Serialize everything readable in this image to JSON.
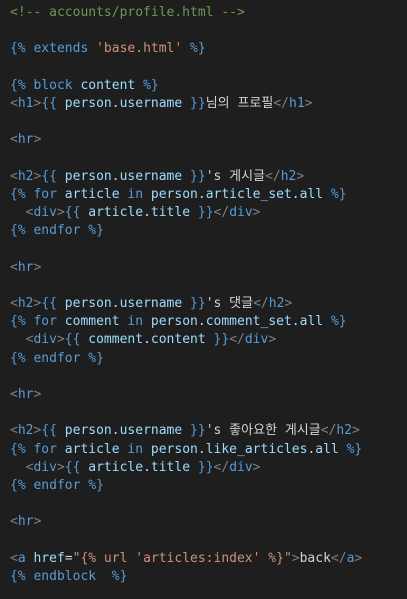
{
  "colors": {
    "background": "#1e1e1e",
    "comment": "#6a9955",
    "delimiter": "#569cd6",
    "keyword": "#569cd6",
    "identifier": "#9cdcfe",
    "string": "#ce9178",
    "punctuation": "#808080",
    "tag": "#569cd6",
    "text": "#d4d4d4",
    "attribute": "#9cdcfe"
  },
  "code_lines": [
    [
      [
        "comment",
        "<!-- accounts/profile.html -->"
      ]
    ],
    [],
    [
      [
        "delim",
        "{%"
      ],
      [
        "text",
        " "
      ],
      [
        "keyword",
        "extends"
      ],
      [
        "text",
        " "
      ],
      [
        "string",
        "'base.html'"
      ],
      [
        "text",
        " "
      ],
      [
        "delim",
        "%}"
      ]
    ],
    [],
    [
      [
        "delim",
        "{%"
      ],
      [
        "text",
        " "
      ],
      [
        "keyword",
        "block"
      ],
      [
        "text",
        " "
      ],
      [
        "ident",
        "content"
      ],
      [
        "text",
        " "
      ],
      [
        "delim",
        "%}"
      ]
    ],
    [
      [
        "punct",
        "<"
      ],
      [
        "tag",
        "h1"
      ],
      [
        "punct",
        ">"
      ],
      [
        "delim",
        "{{"
      ],
      [
        "text",
        " "
      ],
      [
        "ident",
        "person"
      ],
      [
        "text",
        "."
      ],
      [
        "ident",
        "username"
      ],
      [
        "text",
        " "
      ],
      [
        "delim",
        "}}"
      ],
      [
        "text",
        "님의 프로필"
      ],
      [
        "punct",
        "</"
      ],
      [
        "tag",
        "h1"
      ],
      [
        "punct",
        ">"
      ]
    ],
    [],
    [
      [
        "punct",
        "<"
      ],
      [
        "tag",
        "hr"
      ],
      [
        "punct",
        ">"
      ]
    ],
    [],
    [
      [
        "punct",
        "<"
      ],
      [
        "tag",
        "h2"
      ],
      [
        "punct",
        ">"
      ],
      [
        "delim",
        "{{"
      ],
      [
        "text",
        " "
      ],
      [
        "ident",
        "person"
      ],
      [
        "text",
        "."
      ],
      [
        "ident",
        "username"
      ],
      [
        "text",
        " "
      ],
      [
        "delim",
        "}}"
      ],
      [
        "text",
        "'s 게시글"
      ],
      [
        "punct",
        "</"
      ],
      [
        "tag",
        "h2"
      ],
      [
        "punct",
        ">"
      ]
    ],
    [
      [
        "delim",
        "{%"
      ],
      [
        "text",
        " "
      ],
      [
        "keyword",
        "for"
      ],
      [
        "text",
        " "
      ],
      [
        "ident",
        "article"
      ],
      [
        "text",
        " "
      ],
      [
        "keyword",
        "in"
      ],
      [
        "text",
        " "
      ],
      [
        "ident",
        "person"
      ],
      [
        "text",
        "."
      ],
      [
        "ident",
        "article_set"
      ],
      [
        "text",
        "."
      ],
      [
        "ident",
        "all"
      ],
      [
        "text",
        " "
      ],
      [
        "delim",
        "%}"
      ]
    ],
    [
      [
        "text",
        "  "
      ],
      [
        "punct",
        "<"
      ],
      [
        "tag",
        "div"
      ],
      [
        "punct",
        ">"
      ],
      [
        "delim",
        "{{"
      ],
      [
        "text",
        " "
      ],
      [
        "ident",
        "article"
      ],
      [
        "text",
        "."
      ],
      [
        "ident",
        "title"
      ],
      [
        "text",
        " "
      ],
      [
        "delim",
        "}}"
      ],
      [
        "punct",
        "</"
      ],
      [
        "tag",
        "div"
      ],
      [
        "punct",
        ">"
      ]
    ],
    [
      [
        "delim",
        "{%"
      ],
      [
        "text",
        " "
      ],
      [
        "keyword",
        "endfor"
      ],
      [
        "text",
        " "
      ],
      [
        "delim",
        "%}"
      ]
    ],
    [],
    [
      [
        "punct",
        "<"
      ],
      [
        "tag",
        "hr"
      ],
      [
        "punct",
        ">"
      ]
    ],
    [],
    [
      [
        "punct",
        "<"
      ],
      [
        "tag",
        "h2"
      ],
      [
        "punct",
        ">"
      ],
      [
        "delim",
        "{{"
      ],
      [
        "text",
        " "
      ],
      [
        "ident",
        "person"
      ],
      [
        "text",
        "."
      ],
      [
        "ident",
        "username"
      ],
      [
        "text",
        " "
      ],
      [
        "delim",
        "}}"
      ],
      [
        "text",
        "'s 댓글"
      ],
      [
        "punct",
        "</"
      ],
      [
        "tag",
        "h2"
      ],
      [
        "punct",
        ">"
      ]
    ],
    [
      [
        "delim",
        "{%"
      ],
      [
        "text",
        " "
      ],
      [
        "keyword",
        "for"
      ],
      [
        "text",
        " "
      ],
      [
        "ident",
        "comment"
      ],
      [
        "text",
        " "
      ],
      [
        "keyword",
        "in"
      ],
      [
        "text",
        " "
      ],
      [
        "ident",
        "person"
      ],
      [
        "text",
        "."
      ],
      [
        "ident",
        "comment_set"
      ],
      [
        "text",
        "."
      ],
      [
        "ident",
        "all"
      ],
      [
        "text",
        " "
      ],
      [
        "delim",
        "%}"
      ]
    ],
    [
      [
        "text",
        "  "
      ],
      [
        "punct",
        "<"
      ],
      [
        "tag",
        "div"
      ],
      [
        "punct",
        ">"
      ],
      [
        "delim",
        "{{"
      ],
      [
        "text",
        " "
      ],
      [
        "ident",
        "comment"
      ],
      [
        "text",
        "."
      ],
      [
        "ident",
        "content"
      ],
      [
        "text",
        " "
      ],
      [
        "delim",
        "}}"
      ],
      [
        "punct",
        "</"
      ],
      [
        "tag",
        "div"
      ],
      [
        "punct",
        ">"
      ]
    ],
    [
      [
        "delim",
        "{%"
      ],
      [
        "text",
        " "
      ],
      [
        "keyword",
        "endfor"
      ],
      [
        "text",
        " "
      ],
      [
        "delim",
        "%}"
      ]
    ],
    [],
    [
      [
        "punct",
        "<"
      ],
      [
        "tag",
        "hr"
      ],
      [
        "punct",
        ">"
      ]
    ],
    [],
    [
      [
        "punct",
        "<"
      ],
      [
        "tag",
        "h2"
      ],
      [
        "punct",
        ">"
      ],
      [
        "delim",
        "{{"
      ],
      [
        "text",
        " "
      ],
      [
        "ident",
        "person"
      ],
      [
        "text",
        "."
      ],
      [
        "ident",
        "username"
      ],
      [
        "text",
        " "
      ],
      [
        "delim",
        "}}"
      ],
      [
        "text",
        "'s 좋아요한 게시글"
      ],
      [
        "punct",
        "</"
      ],
      [
        "tag",
        "h2"
      ],
      [
        "punct",
        ">"
      ]
    ],
    [
      [
        "delim",
        "{%"
      ],
      [
        "text",
        " "
      ],
      [
        "keyword",
        "for"
      ],
      [
        "text",
        " "
      ],
      [
        "ident",
        "article"
      ],
      [
        "text",
        " "
      ],
      [
        "keyword",
        "in"
      ],
      [
        "text",
        " "
      ],
      [
        "ident",
        "person"
      ],
      [
        "text",
        "."
      ],
      [
        "ident",
        "like_articles"
      ],
      [
        "text",
        "."
      ],
      [
        "ident",
        "all"
      ],
      [
        "text",
        " "
      ],
      [
        "delim",
        "%}"
      ]
    ],
    [
      [
        "text",
        "  "
      ],
      [
        "punct",
        "<"
      ],
      [
        "tag",
        "div"
      ],
      [
        "punct",
        ">"
      ],
      [
        "delim",
        "{{"
      ],
      [
        "text",
        " "
      ],
      [
        "ident",
        "article"
      ],
      [
        "text",
        "."
      ],
      [
        "ident",
        "title"
      ],
      [
        "text",
        " "
      ],
      [
        "delim",
        "}}"
      ],
      [
        "punct",
        "</"
      ],
      [
        "tag",
        "div"
      ],
      [
        "punct",
        ">"
      ]
    ],
    [
      [
        "delim",
        "{%"
      ],
      [
        "text",
        " "
      ],
      [
        "keyword",
        "endfor"
      ],
      [
        "text",
        " "
      ],
      [
        "delim",
        "%}"
      ]
    ],
    [],
    [
      [
        "punct",
        "<"
      ],
      [
        "tag",
        "hr"
      ],
      [
        "punct",
        ">"
      ]
    ],
    [],
    [
      [
        "punct",
        "<"
      ],
      [
        "tag",
        "a"
      ],
      [
        "text",
        " "
      ],
      [
        "attr",
        "href"
      ],
      [
        "text",
        "="
      ],
      [
        "string",
        "\"{% url 'articles:index' %}\""
      ],
      [
        "punct",
        ">"
      ],
      [
        "text",
        "back"
      ],
      [
        "punct",
        "</"
      ],
      [
        "tag",
        "a"
      ],
      [
        "punct",
        ">"
      ]
    ],
    [
      [
        "delim",
        "{%"
      ],
      [
        "text",
        " "
      ],
      [
        "keyword",
        "endblock"
      ],
      [
        "text",
        "  "
      ],
      [
        "delim",
        "%}"
      ]
    ]
  ]
}
